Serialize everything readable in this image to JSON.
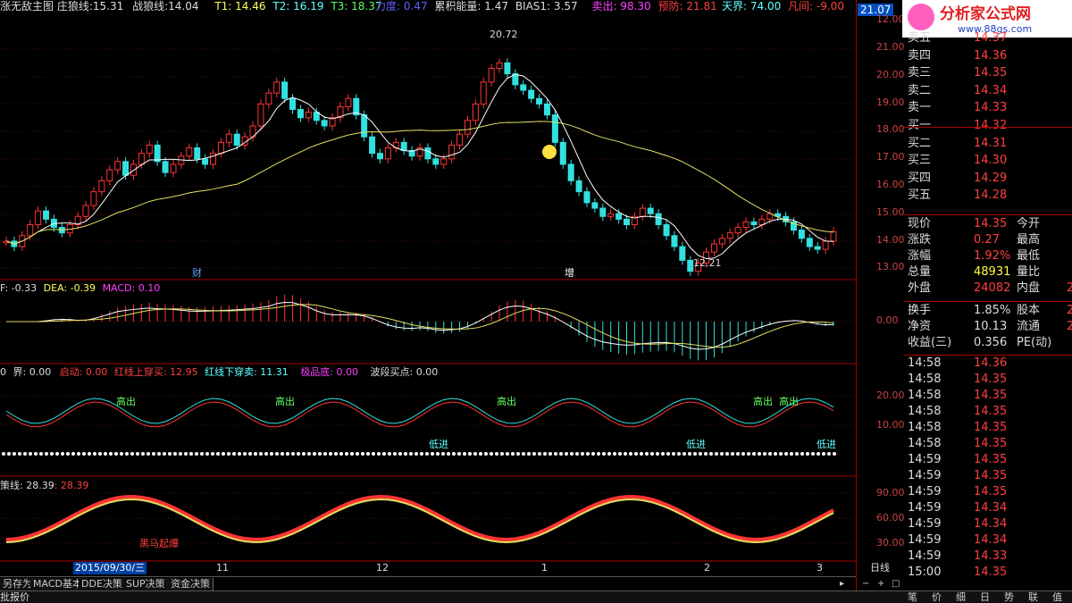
{
  "header": {
    "main": {
      "title": "涨无敌主图",
      "z_label": "庄狼线:",
      "z_value": "15.31",
      "zh_label": "战狼线:",
      "zh_value": "14.04",
      "t1": "T1: 14.46",
      "t2": "T2: 16.19",
      "t3": "T3: 18.37",
      "lidu": "力度: 0.47",
      "leiji": "累积能量: 1.47",
      "bias": "BIAS1: 3.57",
      "maichu": "卖出: 98.30",
      "yufang": "预防: 21.81",
      "tianjie": "天界: 74.00",
      "fanjian": "凡间: -9.00",
      "price_tag": "21.07"
    },
    "macd": {
      "dif": "F: -0.33",
      "dea": "DEA: -0.39",
      "macd": "MACD: 0.10"
    },
    "ind3": {
      "a": "0",
      "jie": "界: 0.00",
      "qidong": "启动: 0.00",
      "up": "红线上穿买: 12.95",
      "down": "红线下穿卖: 11.31",
      "jipin": "极品底: 0.00",
      "boduan": "波段买点: 0.00"
    },
    "ind4": {
      "label": "策线: 28.39",
      "value": ": 28.39"
    }
  },
  "price_axis": [
    "21.00",
    "20.00",
    "19.00",
    "18.00",
    "17.00",
    "16.00",
    "15.00",
    "14.00",
    "13.00",
    "12.00"
  ],
  "macd_axis": [
    "0.00"
  ],
  "ind3_axis": [
    "20.00",
    "10.00"
  ],
  "ind4_axis": [
    "90.00",
    "60.00",
    "30.00"
  ],
  "annotations": {
    "high": "20.72",
    "low": "12.21",
    "cai": "财",
    "zeng": "增",
    "gaochu": "高出",
    "dijin": "低进",
    "heima": "黑马起爆"
  },
  "dates": {
    "d1": "2015/09/30/三",
    "d2": "11",
    "d3": "12",
    "d4": "1",
    "d5": "2",
    "d6": "3",
    "period": "日线"
  },
  "tabs": [
    "另存为",
    "MACD基本",
    "DDE决策",
    "SUP决策",
    "资金决策"
  ],
  "bottom_left": "批报价",
  "bottom_right_tabs": [
    "笔",
    "价",
    "细",
    "日",
    "势",
    "联",
    "值"
  ],
  "logo": {
    "text": "分析家公式网",
    "url": "www.88gs.com"
  },
  "orderbook": [
    {
      "k": "卖五",
      "v": "14.37"
    },
    {
      "k": "卖四",
      "v": "14.36"
    },
    {
      "k": "卖三",
      "v": "14.35"
    },
    {
      "k": "卖二",
      "v": "14.34"
    },
    {
      "k": "卖一",
      "v": "14.33"
    },
    {
      "k": "买一",
      "v": "14.32"
    },
    {
      "k": "买二",
      "v": "14.31"
    },
    {
      "k": "买三",
      "v": "14.30"
    },
    {
      "k": "买四",
      "v": "14.29"
    },
    {
      "k": "买五",
      "v": "14.28"
    }
  ],
  "stats": [
    {
      "k": "现价",
      "v": "14.35",
      "k2": "今开",
      "v2": ""
    },
    {
      "k": "涨跌",
      "v": "0.27",
      "k2": "最高",
      "v2": ""
    },
    {
      "k": "涨幅",
      "v": "1.92%",
      "k2": "最低",
      "v2": ""
    },
    {
      "k": "总量",
      "v": "48931",
      "k2": "量比",
      "v2": ""
    },
    {
      "k": "外盘",
      "v": "24082",
      "k2": "内盘",
      "v2": "2"
    }
  ],
  "stats2": [
    {
      "k": "换手",
      "v": "1.85%",
      "k2": "股本",
      "v2": "2"
    },
    {
      "k": "净资",
      "v": "10.13",
      "k2": "流通",
      "v2": "2"
    },
    {
      "k": "收益(三)",
      "v": "0.356",
      "k2": "PE(动)",
      "v2": ""
    }
  ],
  "ticks": [
    {
      "t": "14:58",
      "p": "14.36"
    },
    {
      "t": "14:58",
      "p": "14.35"
    },
    {
      "t": "14:58",
      "p": "14.35"
    },
    {
      "t": "14:58",
      "p": "14.35"
    },
    {
      "t": "14:58",
      "p": "14.35"
    },
    {
      "t": "14:58",
      "p": "14.35"
    },
    {
      "t": "14:59",
      "p": "14.35"
    },
    {
      "t": "14:59",
      "p": "14.35"
    },
    {
      "t": "14:59",
      "p": "14.35"
    },
    {
      "t": "14:59",
      "p": "14.34"
    },
    {
      "t": "14:59",
      "p": "14.34"
    },
    {
      "t": "14:59",
      "p": "14.34"
    },
    {
      "t": "14:59",
      "p": "14.33"
    },
    {
      "t": "15:00",
      "p": "14.35"
    }
  ],
  "colors": {
    "up": "#ff3333",
    "down": "#33e0e0",
    "ma_white": "#ffffff",
    "ma_yellow": "#e0e060",
    "axis": "#aa0000"
  }
}
